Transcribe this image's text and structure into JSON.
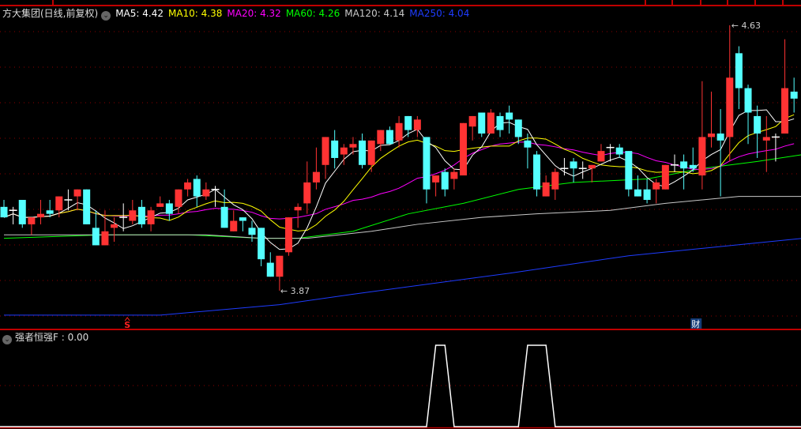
{
  "header": {
    "title": "方大集团(日线,前复权)",
    "ma_labels": [
      {
        "text": "MA5: 4.42",
        "color": "#ffffff"
      },
      {
        "text": "MA10: 4.38",
        "color": "#ffff00"
      },
      {
        "text": "MA20: 4.32",
        "color": "#ff00ff"
      },
      {
        "text": "MA60: 4.26",
        "color": "#00ff00"
      },
      {
        "text": "MA120: 4.14",
        "color": "#c8c8c8"
      },
      {
        "text": "MA250: 4.04",
        "color": "#1e3cff"
      }
    ]
  },
  "annotations": {
    "high_label": "4.63",
    "low_label": "3.87",
    "signal_marker": "S",
    "finance_marker": "财"
  },
  "indicator": {
    "label": "强者恒强F : 0.00"
  },
  "colors": {
    "up": "#ff3333",
    "down": "#54ffff",
    "doji": "#ffffff",
    "grid": "#8b0000",
    "divider": "#c00000"
  },
  "chart_data": {
    "type": "candlestick",
    "title": "方大集团(日线,前复权)",
    "fields": [
      "open",
      "close",
      "high",
      "low"
    ],
    "high_marker": 4.63,
    "low_marker": 3.87,
    "candles": [
      [
        4.11,
        4.08,
        4.13,
        4.08
      ],
      [
        4.1,
        4.1,
        4.11,
        4.06
      ],
      [
        4.13,
        4.06,
        4.13,
        4.05
      ],
      [
        4.06,
        4.08,
        4.08,
        4.03
      ],
      [
        4.08,
        4.09,
        4.13,
        4.06
      ],
      [
        4.1,
        4.09,
        4.13,
        4.08
      ],
      [
        4.1,
        4.14,
        4.14,
        4.08
      ],
      [
        4.13,
        4.13,
        4.16,
        4.1
      ],
      [
        4.14,
        4.16,
        4.16,
        4.1
      ],
      [
        4.16,
        4.06,
        4.16,
        4.06
      ],
      [
        4.05,
        4.0,
        4.1,
        4.0
      ],
      [
        4.0,
        4.04,
        4.1,
        4.0
      ],
      [
        4.05,
        4.06,
        4.08,
        4.01
      ],
      [
        4.08,
        4.08,
        4.12,
        4.04
      ],
      [
        4.07,
        4.1,
        4.13,
        4.06
      ],
      [
        4.11,
        4.06,
        4.13,
        4.05
      ],
      [
        4.06,
        4.1,
        4.11,
        4.04
      ],
      [
        4.11,
        4.12,
        4.14,
        4.11
      ],
      [
        4.12,
        4.09,
        4.13,
        4.07
      ],
      [
        4.11,
        4.16,
        4.16,
        4.09
      ],
      [
        4.16,
        4.18,
        4.19,
        4.14
      ],
      [
        4.19,
        4.14,
        4.2,
        4.11
      ],
      [
        4.14,
        4.16,
        4.18,
        4.13
      ],
      [
        4.16,
        4.16,
        4.17,
        4.11
      ],
      [
        4.11,
        4.05,
        4.16,
        4.05
      ],
      [
        4.04,
        4.07,
        4.1,
        4.04
      ],
      [
        4.08,
        4.07,
        4.08,
        4.04
      ],
      [
        4.05,
        4.03,
        4.07,
        4.01
      ],
      [
        4.05,
        3.96,
        4.05,
        3.94
      ],
      [
        3.95,
        3.91,
        3.98,
        3.91
      ],
      [
        3.91,
        3.97,
        3.97,
        3.87
      ],
      [
        3.98,
        4.08,
        4.08,
        3.97
      ],
      [
        4.1,
        4.11,
        4.12,
        4.05
      ],
      [
        4.12,
        4.18,
        4.24,
        4.09
      ],
      [
        4.18,
        4.21,
        4.28,
        4.16
      ],
      [
        4.23,
        4.31,
        4.31,
        4.19
      ],
      [
        4.3,
        4.25,
        4.33,
        4.22
      ],
      [
        4.26,
        4.28,
        4.29,
        4.23
      ],
      [
        4.28,
        4.29,
        4.31,
        4.26
      ],
      [
        4.3,
        4.23,
        4.32,
        4.22
      ],
      [
        4.23,
        4.3,
        4.3,
        4.21
      ],
      [
        4.29,
        4.33,
        4.33,
        4.27
      ],
      [
        4.33,
        4.29,
        4.34,
        4.29
      ],
      [
        4.3,
        4.35,
        4.37,
        4.28
      ],
      [
        4.37,
        4.33,
        4.37,
        4.31
      ],
      [
        4.33,
        4.36,
        4.37,
        4.31
      ],
      [
        4.31,
        4.16,
        4.31,
        4.12
      ],
      [
        4.18,
        4.2,
        4.2,
        4.14
      ],
      [
        4.21,
        4.16,
        4.22,
        4.14
      ],
      [
        4.19,
        4.21,
        4.22,
        4.16
      ],
      [
        4.2,
        4.35,
        4.35,
        4.2
      ],
      [
        4.34,
        4.37,
        4.37,
        4.3
      ],
      [
        4.38,
        4.32,
        4.38,
        4.31
      ],
      [
        4.32,
        4.38,
        4.39,
        4.32
      ],
      [
        4.37,
        4.33,
        4.38,
        4.31
      ],
      [
        4.38,
        4.36,
        4.4,
        4.32
      ],
      [
        4.36,
        4.31,
        4.36,
        4.29
      ],
      [
        4.3,
        4.28,
        4.32,
        4.22
      ],
      [
        4.26,
        4.16,
        4.27,
        4.14
      ],
      [
        4.14,
        4.18,
        4.2,
        4.14
      ],
      [
        4.16,
        4.21,
        4.22,
        4.13
      ],
      [
        4.22,
        4.22,
        4.25,
        4.2
      ],
      [
        4.24,
        4.22,
        4.25,
        4.18
      ],
      [
        4.22,
        4.22,
        4.24,
        4.19
      ],
      [
        4.22,
        4.23,
        4.23,
        4.18
      ],
      [
        4.24,
        4.27,
        4.29,
        4.24
      ],
      [
        4.28,
        4.28,
        4.29,
        4.24
      ],
      [
        4.28,
        4.26,
        4.29,
        4.25
      ],
      [
        4.27,
        4.16,
        4.27,
        4.14
      ],
      [
        4.16,
        4.14,
        4.2,
        4.14
      ],
      [
        4.16,
        4.13,
        4.19,
        4.12
      ],
      [
        4.16,
        4.18,
        4.19,
        4.12
      ],
      [
        4.16,
        4.23,
        4.23,
        4.16
      ],
      [
        4.23,
        4.23,
        4.26,
        4.21
      ],
      [
        4.24,
        4.22,
        4.26,
        4.16
      ],
      [
        4.23,
        4.22,
        4.28,
        4.21
      ],
      [
        4.2,
        4.31,
        4.47,
        4.16
      ],
      [
        4.31,
        4.32,
        4.44,
        4.28
      ],
      [
        4.32,
        4.3,
        4.39,
        4.14
      ],
      [
        4.31,
        4.48,
        4.63,
        4.24
      ],
      [
        4.55,
        4.45,
        4.57,
        4.39
      ],
      [
        4.45,
        4.38,
        4.46,
        4.29
      ],
      [
        4.37,
        4.32,
        4.4,
        4.25
      ],
      [
        4.3,
        4.31,
        4.37,
        4.21
      ],
      [
        4.31,
        4.31,
        4.32,
        4.24
      ],
      [
        4.32,
        4.45,
        4.59,
        4.32
      ],
      [
        4.44,
        4.42,
        4.48,
        4.38
      ]
    ],
    "ma_long": {
      "MA60": [
        [
          0,
          4.02
        ],
        [
          11,
          4.03
        ],
        [
          20,
          4.03
        ],
        [
          28,
          4.02
        ],
        [
          32,
          4.02
        ],
        [
          38,
          4.04
        ],
        [
          44,
          4.09
        ],
        [
          50,
          4.12
        ],
        [
          56,
          4.16
        ],
        [
          62,
          4.18
        ],
        [
          70,
          4.19
        ],
        [
          76,
          4.22
        ],
        [
          82,
          4.24
        ],
        [
          87,
          4.26
        ]
      ],
      "MA120": [
        [
          0,
          4.03
        ],
        [
          12,
          4.03
        ],
        [
          22,
          4.03
        ],
        [
          28,
          4.02
        ],
        [
          33,
          4.02
        ],
        [
          40,
          4.04
        ],
        [
          45,
          4.06
        ],
        [
          52,
          4.08
        ],
        [
          58,
          4.09
        ],
        [
          66,
          4.1
        ],
        [
          72,
          4.12
        ],
        [
          80,
          4.14
        ],
        [
          87,
          4.14
        ]
      ],
      "MA250": [
        [
          0,
          3.8
        ],
        [
          17,
          3.8
        ],
        [
          30,
          3.83
        ],
        [
          38,
          3.86
        ],
        [
          55,
          3.92
        ],
        [
          68,
          3.97
        ],
        [
          87,
          4.02
        ]
      ]
    },
    "indicator_values": [
      0,
      0,
      0,
      0,
      0,
      0,
      0,
      0,
      0,
      0,
      0,
      0,
      0,
      0,
      0,
      0,
      0,
      0,
      0,
      0,
      0,
      0,
      0,
      0,
      0,
      0,
      0,
      0,
      0,
      0,
      0,
      0,
      0,
      0,
      0,
      0,
      0,
      0,
      0,
      0,
      0,
      0,
      0,
      0,
      0,
      0,
      0,
      1,
      1,
      0,
      0,
      0,
      0,
      0,
      0,
      0,
      0,
      1,
      1,
      1,
      0,
      0,
      0,
      0,
      0,
      0,
      0,
      0,
      0,
      0,
      0,
      0,
      0,
      0,
      0,
      0,
      0,
      0,
      0,
      0,
      0,
      0,
      0,
      0,
      0,
      0,
      0
    ],
    "signal_marker_index": 13,
    "finance_marker_index": 75,
    "grid": true
  }
}
